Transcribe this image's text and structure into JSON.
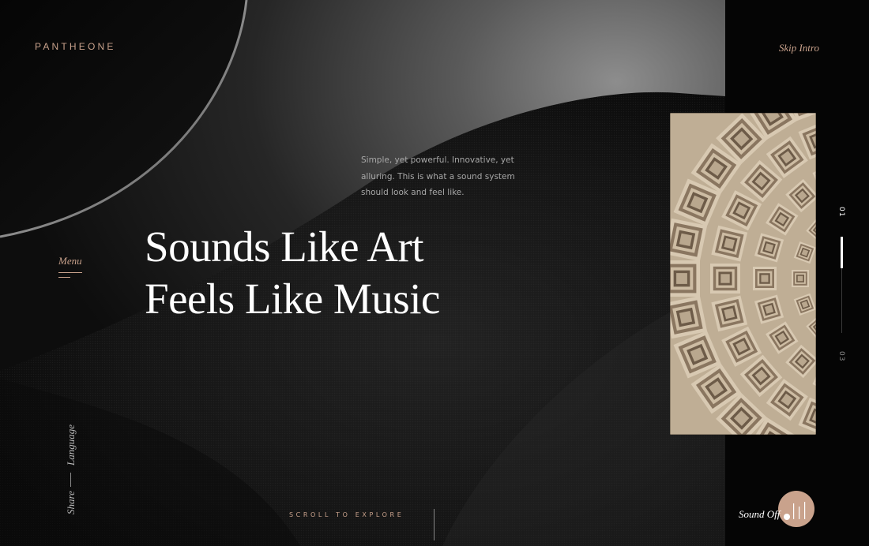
{
  "brand": {
    "logo_text": "PANTHEONE",
    "accent_color": "#c9a28c"
  },
  "header": {
    "skip_intro_label": "Skip Intro"
  },
  "nav": {
    "menu_label": "Menu"
  },
  "hero": {
    "tagline": "Simple, yet powerful. Innovative, yet alluring. This is what a sound system should look and feel like.",
    "headline_line1": "Sounds Like Art",
    "headline_line2": "Feels Like Music"
  },
  "pagination": {
    "current": "01",
    "total": "03",
    "progress_fraction": 0.33
  },
  "side_links": {
    "share_label": "Share",
    "language_label": "Language"
  },
  "footer": {
    "scroll_label": "SCROLL TO EXPLORE",
    "sound_label": "Sound Off"
  },
  "icons": {
    "sound": "sound-bars-icon",
    "menu": "hamburger-lines-icon",
    "image": "pantheon-coffered-ceiling-image"
  }
}
